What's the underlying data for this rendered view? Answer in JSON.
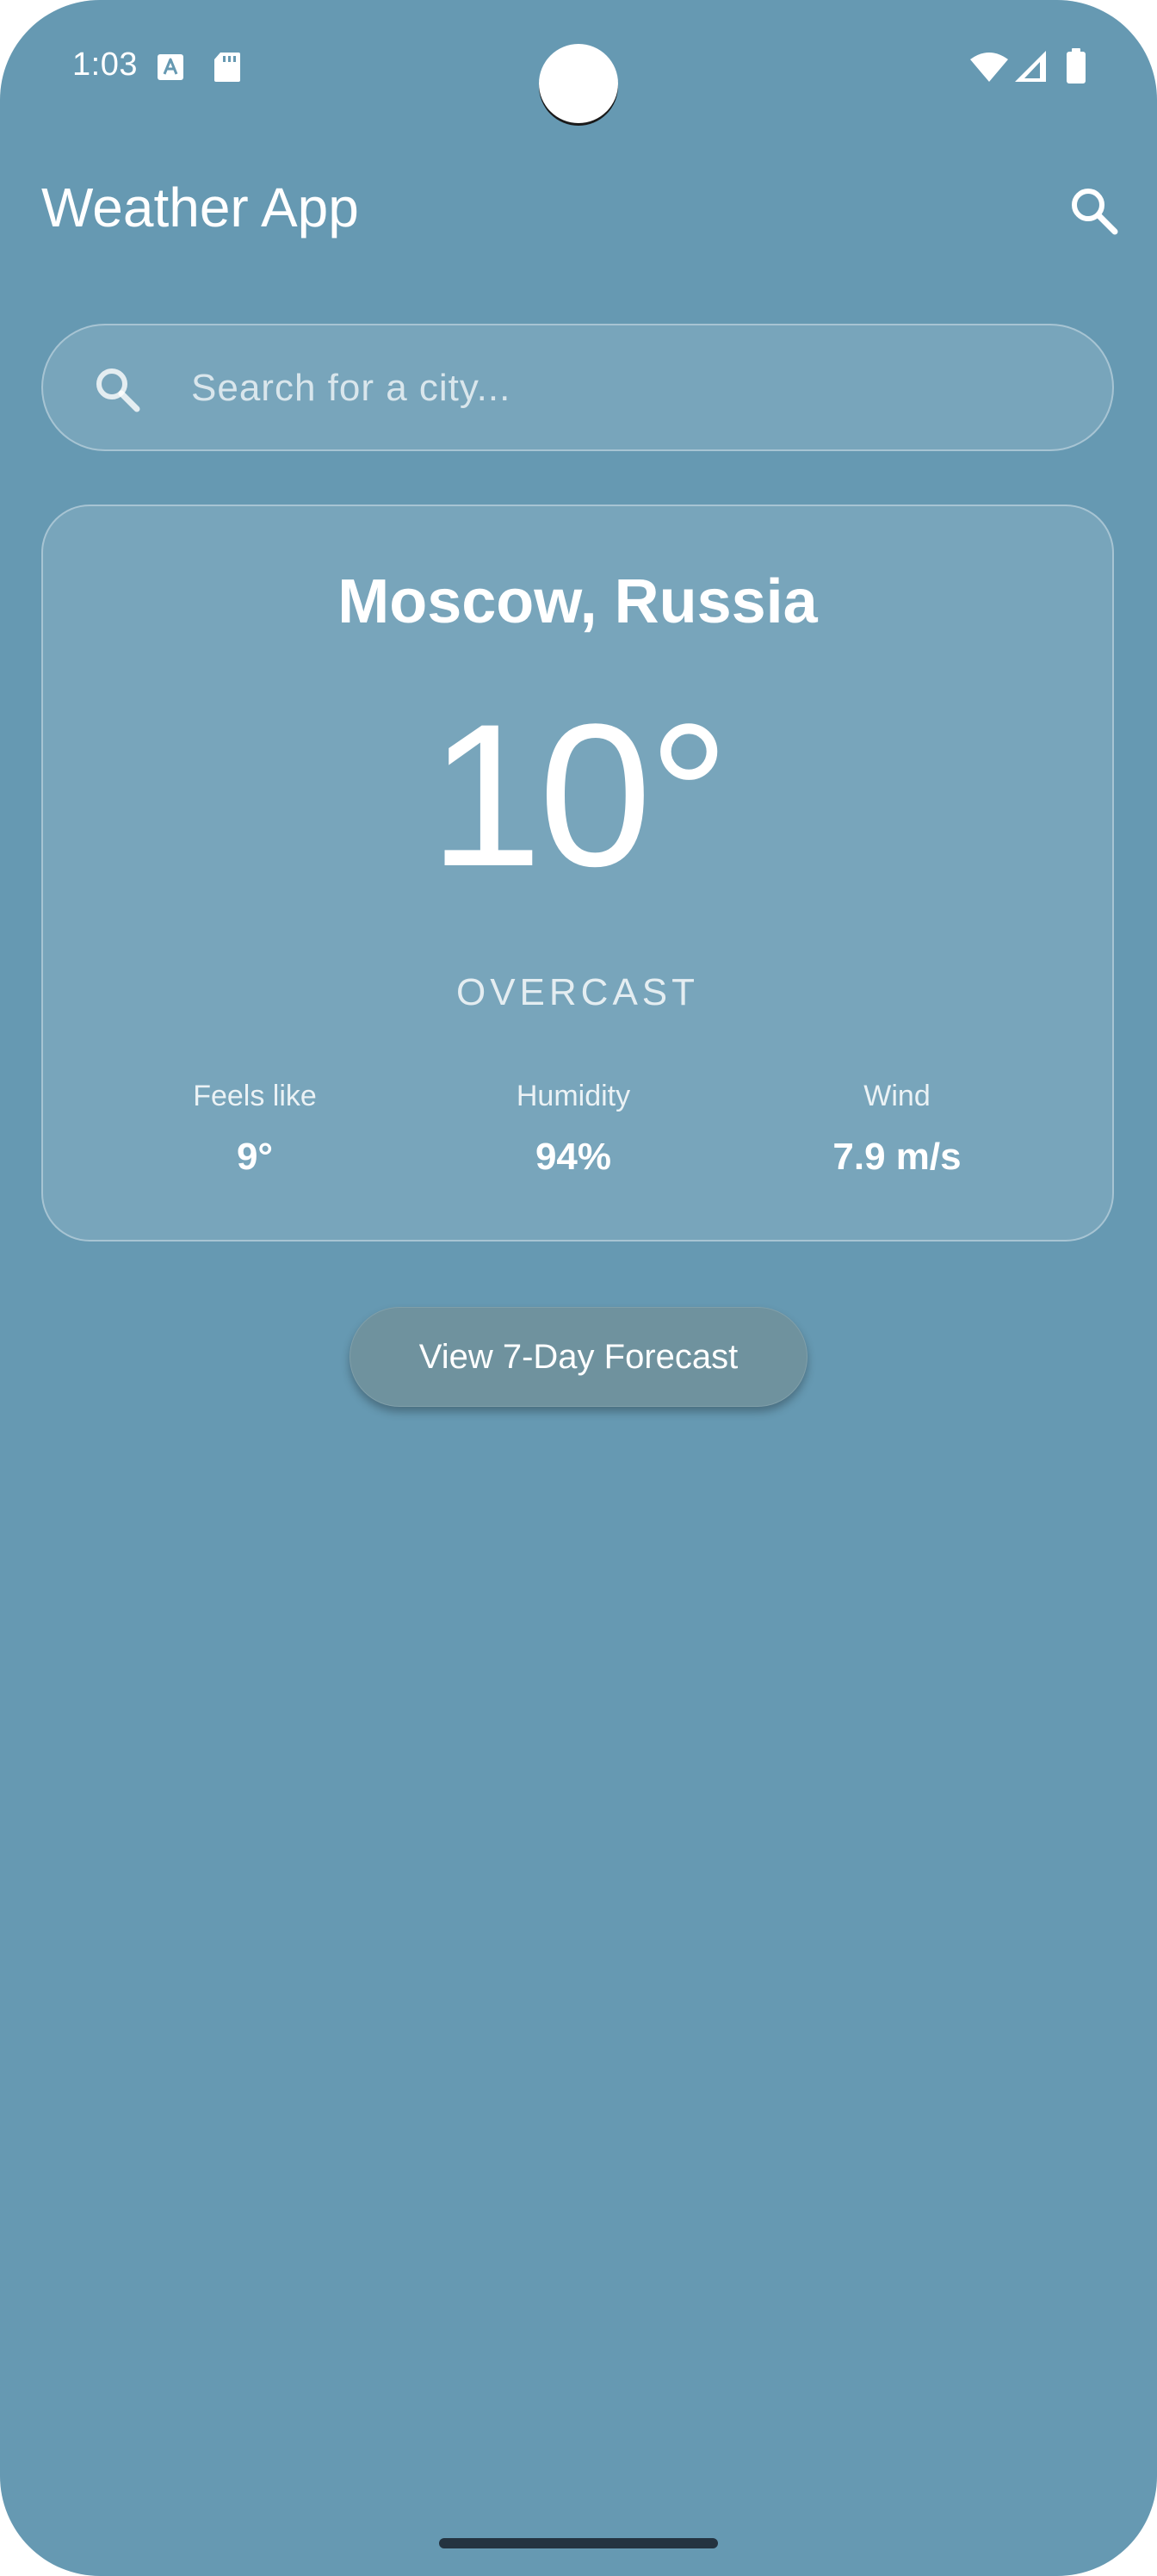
{
  "status_bar": {
    "time": "1:03",
    "icons": [
      "font-notification-icon",
      "sd-card-icon",
      "wifi-icon",
      "cellular-signal-icon",
      "battery-icon"
    ]
  },
  "app_bar": {
    "title": "Weather App",
    "search_icon": "search-icon"
  },
  "search": {
    "placeholder": "Search for a city...",
    "value": "",
    "icon": "search-icon"
  },
  "weather": {
    "city": "Moscow, Russia",
    "temperature": "10°",
    "condition": "OVERCAST",
    "stats": [
      {
        "label": "Feels like",
        "value": "9°"
      },
      {
        "label": "Humidity",
        "value": "94%"
      },
      {
        "label": "Wind",
        "value": "7.9 m/s"
      }
    ]
  },
  "forecast_button": {
    "label": "View 7-Day Forecast"
  },
  "colors": {
    "background": "#6699b2",
    "card": "rgba(255,255,255,0.12)",
    "button": "#6f929e",
    "text": "#ffffff"
  }
}
